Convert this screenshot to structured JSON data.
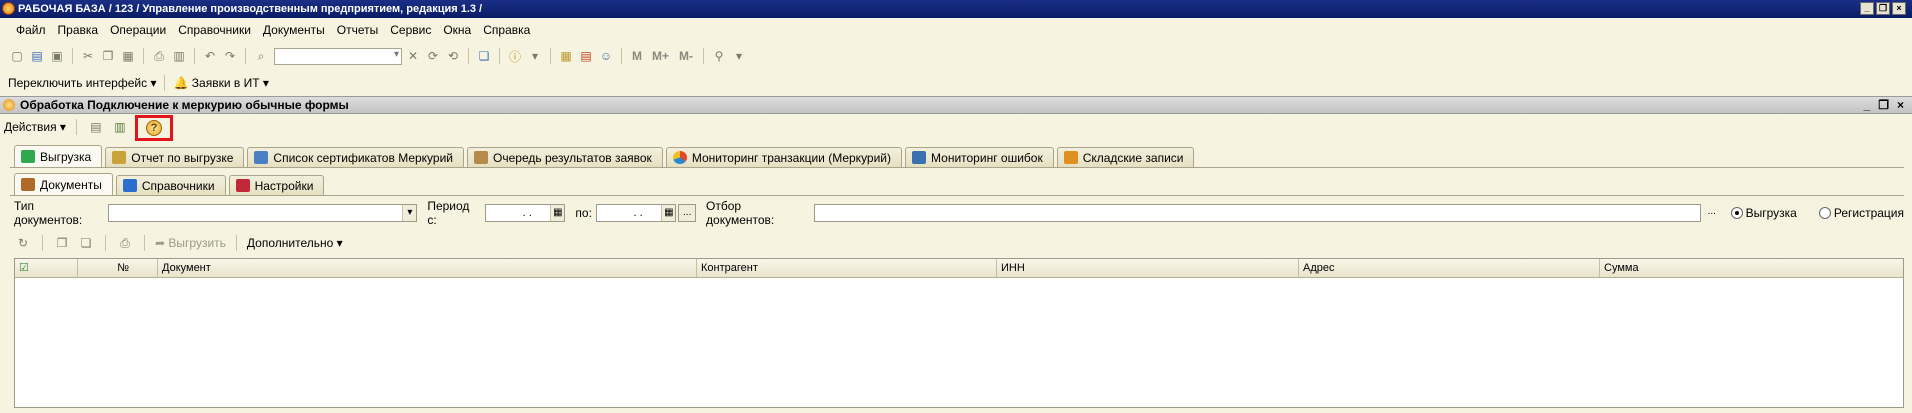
{
  "window": {
    "title": "РАБОЧАЯ БАЗА / 123 /  Управление производственным предприятием, редакция 1.3 /",
    "minimize": "_",
    "restore": "❐",
    "close": "×"
  },
  "menu": [
    "Файл",
    "Правка",
    "Операции",
    "Справочники",
    "Документы",
    "Отчеты",
    "Сервис",
    "Окна",
    "Справка"
  ],
  "toolbar": {
    "letters": [
      "M",
      "M+",
      "M-"
    ]
  },
  "toolbar2": {
    "switch_interface": "Переключить интерфейс",
    "it_requests": "Заявки в ИТ"
  },
  "document": {
    "caption": "Обработка  Подключение к меркурию обычные формы",
    "actions_label": "Действия",
    "help_icon_text": "?"
  },
  "tabs": [
    {
      "label": "Выгрузка",
      "color": "#2fa84f"
    },
    {
      "label": "Отчет по выгрузке",
      "color": "#c9a23a"
    },
    {
      "label": "Список сертификатов Меркурий",
      "color": "#4a7fc4"
    },
    {
      "label": "Очередь результатов заявок",
      "color": "#b58a4a"
    },
    {
      "label": "Мониторинг транзакции (Меркурий)",
      "color": "#e04a2a"
    },
    {
      "label": "Мониторинг ошибок",
      "color": "#3a6fb0"
    },
    {
      "label": "Складские записи",
      "color": "#e09020"
    }
  ],
  "subtabs": [
    {
      "label": "Документы",
      "color": "#b06a2a"
    },
    {
      "label": "Справочники",
      "color": "#2a6fd0"
    },
    {
      "label": "Настройки",
      "color": "#c0283a"
    }
  ],
  "filter": {
    "doc_type_label": "Тип документов:",
    "doc_type_value": "",
    "period_from_label": "Период с:",
    "period_from_value": ". .",
    "period_to_label": "по:",
    "period_to_value": ". .",
    "ellipsis": "...",
    "doc_filter_label": "Отбор документов:",
    "doc_filter_value": "",
    "radio_unload": "Выгрузка",
    "radio_registration": "Регистрация"
  },
  "list_toolbar": {
    "unload_button": "Выгрузить",
    "extra_button": "Дополнительно"
  },
  "grid": {
    "columns": [
      "",
      "№",
      "Документ",
      "Контрагент",
      "ИНН",
      "Адрес",
      "Сумма"
    ],
    "rows": []
  }
}
